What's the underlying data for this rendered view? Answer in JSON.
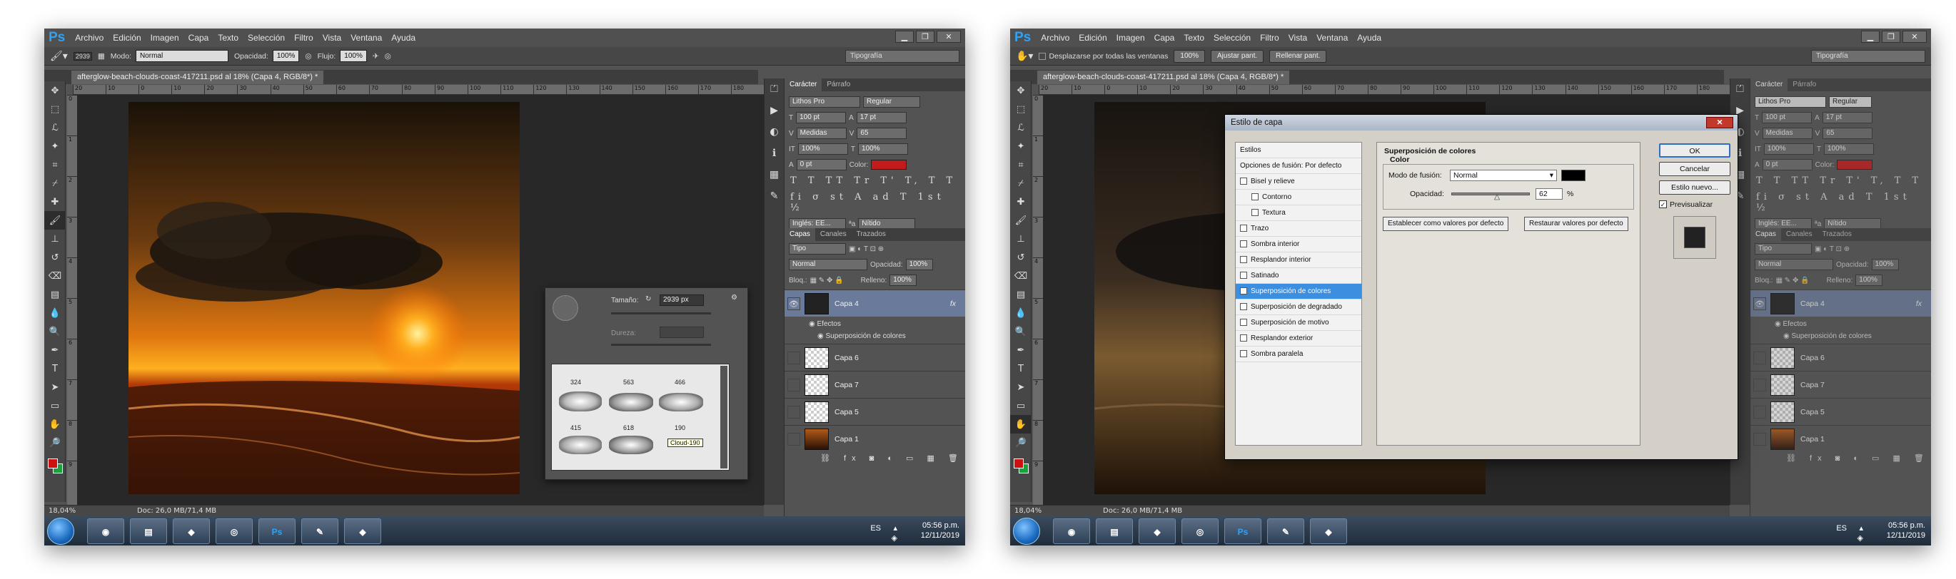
{
  "menu": [
    "Archivo",
    "Edición",
    "Imagen",
    "Capa",
    "Texto",
    "Selección",
    "Filtro",
    "Vista",
    "Ventana",
    "Ayuda"
  ],
  "logo": "Ps",
  "document_tab": "afterglow-beach-clouds-coast-417211.psd al 18% (Capa 4, RGB/8*) *",
  "workspace": "Tipografía",
  "left_options": {
    "brush_size": "2939",
    "mode_label": "Modo:",
    "mode_value": "Normal",
    "opacity_label": "Opacidad:",
    "opacity_value": "100%",
    "flow_label": "Flujo:",
    "flow_value": "100%"
  },
  "right_options": {
    "scroll_all": "Desplazarse por todas las ventanas",
    "btn_100": "100%",
    "btn_fit": "Ajustar pant.",
    "btn_fill": "Rellenar pant."
  },
  "ruler_top": [
    "20",
    "10",
    "0",
    "10",
    "20",
    "30",
    "40",
    "50",
    "60",
    "70",
    "80",
    "90",
    "100",
    "110",
    "120",
    "130",
    "140",
    "150",
    "160",
    "170",
    "180"
  ],
  "ruler_left": [
    "0",
    "1",
    "2",
    "3",
    "4",
    "5",
    "6",
    "7",
    "8",
    "9"
  ],
  "status": {
    "zoom": "18,04%",
    "doc": "Doc: 26,0 MB/71,4 MB"
  },
  "character_panel": {
    "tab_character": "Carácter",
    "tab_paragraph": "Párrafo",
    "font": "Lithos Pro",
    "style": "Regular",
    "size": "100 pt",
    "leading": "17 pt",
    "kerning": "Medidas",
    "tracking": "65",
    "vscale": "100%",
    "hscale": "100%",
    "baseline": "0 pt",
    "color_label": "Color:",
    "glyphs": "T T TT Tr T' T, T T",
    "glyphs2": "fi σ st A ad T 1st ½",
    "language": "Inglés: EE...",
    "aa_icon": "ªa",
    "aa": "Nítido"
  },
  "layers_panel": {
    "tabs": [
      "Capas",
      "Canales",
      "Trazados"
    ],
    "filter": "Tipo",
    "blend": "Normal",
    "opacity_label": "Opacidad:",
    "opacity": "100%",
    "lock_label": "Bloq.:",
    "fill_label": "Relleno:",
    "fill": "100%",
    "layers": [
      "Capa 4",
      "Capa 6",
      "Capa 7",
      "Capa 5",
      "Capa 1"
    ],
    "effects_label": "Efectos",
    "effect_item": "Superposición de colores",
    "fx": "fx"
  },
  "brush_popup": {
    "size_label": "Tamaño:",
    "size_value": "2939 px",
    "hardness_label": "Dureza:",
    "presets": [
      "324",
      "563",
      "466",
      "415",
      "618",
      "190"
    ],
    "tooltip": "Cloud-190"
  },
  "dialog": {
    "title": "Estilo de capa",
    "styles_header": "Estilos",
    "blend_options": "Opciones de fusión: Por defecto",
    "items": [
      {
        "label": "Bisel y relieve",
        "checked": false,
        "indent": false,
        "selected": false
      },
      {
        "label": "Contorno",
        "checked": false,
        "indent": true,
        "selected": false
      },
      {
        "label": "Textura",
        "checked": false,
        "indent": true,
        "selected": false
      },
      {
        "label": "Trazo",
        "checked": false,
        "indent": false,
        "selected": false
      },
      {
        "label": "Sombra interior",
        "checked": false,
        "indent": false,
        "selected": false
      },
      {
        "label": "Resplandor interior",
        "checked": false,
        "indent": false,
        "selected": false
      },
      {
        "label": "Satinado",
        "checked": false,
        "indent": false,
        "selected": false
      },
      {
        "label": "Superposición de colores",
        "checked": true,
        "indent": false,
        "selected": true
      },
      {
        "label": "Superposición de degradado",
        "checked": false,
        "indent": false,
        "selected": false
      },
      {
        "label": "Superposición de motivo",
        "checked": false,
        "indent": false,
        "selected": false
      },
      {
        "label": "Resplandor exterior",
        "checked": false,
        "indent": false,
        "selected": false
      },
      {
        "label": "Sombra paralela",
        "checked": false,
        "indent": false,
        "selected": false
      }
    ],
    "section_title": "Superposición de colores",
    "group_title": "Color",
    "blend_mode_label": "Modo de fusión:",
    "blend_mode_value": "Normal",
    "opacity_label": "Opacidad:",
    "opacity_value": "62",
    "percent": "%",
    "btn_default": "Establecer como valores por defecto",
    "btn_reset": "Restaurar valores por defecto",
    "ok": "OK",
    "cancel": "Cancelar",
    "new_style": "Estilo nuevo...",
    "preview": "Previsualizar",
    "overlay_color": "#000000"
  },
  "taskbar": {
    "lang": "ES",
    "time": "05:56 p.m.",
    "date": "12/11/2019",
    "ps": "Ps"
  },
  "colors": {
    "accent": "#2fa3f7",
    "text_color": "#c31a1a",
    "selected_layer": "#6a7a9a",
    "dialog_selected": "#3b8ee0"
  }
}
